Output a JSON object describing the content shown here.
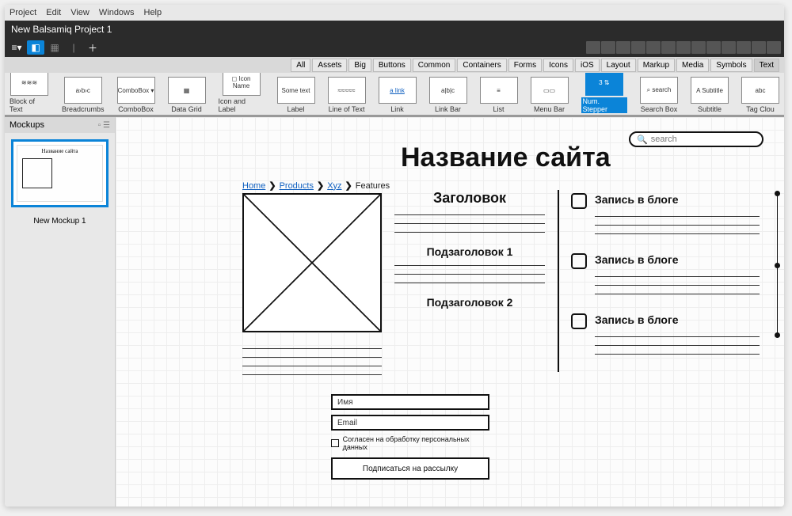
{
  "menubar": [
    "Project",
    "Edit",
    "View",
    "Windows",
    "Help"
  ],
  "window_title": "New Balsamiq Project 1",
  "filter_tabs": [
    "All",
    "Assets",
    "Big",
    "Buttons",
    "Common",
    "Containers",
    "Forms",
    "Icons",
    "iOS",
    "Layout",
    "Markup",
    "Media",
    "Symbols",
    "Text"
  ],
  "filter_selected": "Text",
  "shelf": [
    {
      "label": "Block of Text",
      "thumb": "≋≋≋"
    },
    {
      "label": "Breadcrumbs",
      "thumb": "a›b›c"
    },
    {
      "label": "ComboBox",
      "thumb": "ComboBox ▾"
    },
    {
      "label": "Data Grid",
      "thumb": "▦"
    },
    {
      "label": "Icon and Label",
      "thumb": "◻ Icon Name"
    },
    {
      "label": "Label",
      "thumb": "Some text"
    },
    {
      "label": "Line of Text",
      "thumb": "≈≈≈≈≈"
    },
    {
      "label": "Link",
      "thumb": "a link"
    },
    {
      "label": "Link Bar",
      "thumb": "a|b|c"
    },
    {
      "label": "List",
      "thumb": "≡"
    },
    {
      "label": "Menu Bar",
      "thumb": "▭▭"
    },
    {
      "label": "Num. Stepper",
      "thumb": "3 ⇅"
    },
    {
      "label": "Search Box",
      "thumb": "⌕ search"
    },
    {
      "label": "Subtitle",
      "thumb": "A Subtitle"
    },
    {
      "label": "Tag Clou",
      "thumb": "abc"
    }
  ],
  "shelf_selected": "Num. Stepper",
  "mockups_panel": {
    "title": "Mockups",
    "thumb_label": "New Mockup 1",
    "thumb_title": "Название сайта"
  },
  "canvas": {
    "site_title": "Название сайта",
    "search_placeholder": "search",
    "breadcrumbs": [
      "Home",
      "Products",
      "Xyz",
      "Features"
    ],
    "heading": "Заголовок",
    "sub1": "Подзаголовок 1",
    "sub2": "Подзаголовок 2",
    "blog_title": "Запись в блоге",
    "form": {
      "name_ph": "Имя",
      "email_ph": "Email",
      "consent": "Согласен на обработку персональных данных",
      "submit": "Подписаться на рассылку"
    }
  }
}
